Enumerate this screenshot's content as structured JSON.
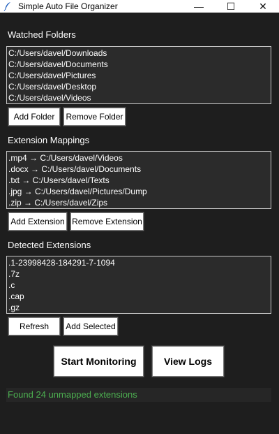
{
  "window": {
    "title": "Simple Auto File Organizer",
    "minimize_glyph": "—",
    "maximize_glyph": "☐",
    "close_glyph": "✕"
  },
  "watched_folders": {
    "label": "Watched Folders",
    "items": [
      "C:/Users/davel/Downloads",
      "C:/Users/davel/Documents",
      "C:/Users/davel/Pictures",
      "C:/Users/davel/Desktop",
      "C:/Users/davel/Videos"
    ],
    "add_label": "Add Folder",
    "remove_label": "Remove Folder"
  },
  "extension_mappings": {
    "label": "Extension Mappings",
    "items": [
      ".mp4 → C:/Users/davel/Videos",
      ".docx → C:/Users/davel/Documents",
      ".txt → C:/Users/davel/Texts",
      ".jpg → C:/Users/davel/Pictures/Dump",
      ".zip → C:/Users/davel/Zips"
    ],
    "add_label": "Add Extension",
    "remove_label": "Remove Extension"
  },
  "detected_extensions": {
    "label": "Detected Extensions",
    "items": [
      ".1-23998428-184291-7-1094",
      ".7z",
      ".c",
      ".cap",
      ".gz"
    ],
    "refresh_label": "Refresh",
    "add_selected_label": "Add Selected"
  },
  "actions": {
    "start_label": "Start Monitoring",
    "logs_label": "View Logs"
  },
  "status": {
    "text": "Found 24 unmapped extensions",
    "color": "#4caf50"
  },
  "colors": {
    "background": "#1e1e1e",
    "listbox_bg": "#2b2b2b",
    "text": "#ffffff"
  }
}
